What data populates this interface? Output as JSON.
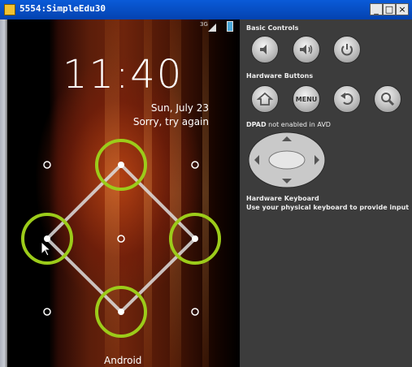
{
  "window": {
    "title": "5554:SimpleEdu30",
    "minimize_label": "_",
    "maximize_label": "□",
    "close_label": "×"
  },
  "statusbar": {
    "network": "3G"
  },
  "lockscreen": {
    "time": "11:40",
    "date": "Sun, July 23",
    "message": "Sorry, try again",
    "carrier": "Android",
    "pattern_grid": "3x3",
    "pattern_path": [
      2,
      4,
      8,
      6
    ],
    "colors": {
      "highlight_ring": "#9ccc1a",
      "path_line": "#dedede",
      "dot": "#ffffff"
    }
  },
  "controls": {
    "basic_label": "Basic Controls",
    "basic": [
      {
        "name": "volume-down-icon"
      },
      {
        "name": "volume-up-icon"
      },
      {
        "name": "power-icon"
      }
    ],
    "hardware_label": "Hardware Buttons",
    "hardware": [
      {
        "name": "home-icon"
      },
      {
        "name": "menu-button",
        "label": "MENU"
      },
      {
        "name": "back-icon"
      },
      {
        "name": "search-icon"
      }
    ],
    "dpad_label": "DPAD",
    "dpad_note": " not enabled in AVD",
    "keyboard_label": "Hardware Keyboard",
    "keyboard_text": "Use your physical keyboard to provide input"
  }
}
